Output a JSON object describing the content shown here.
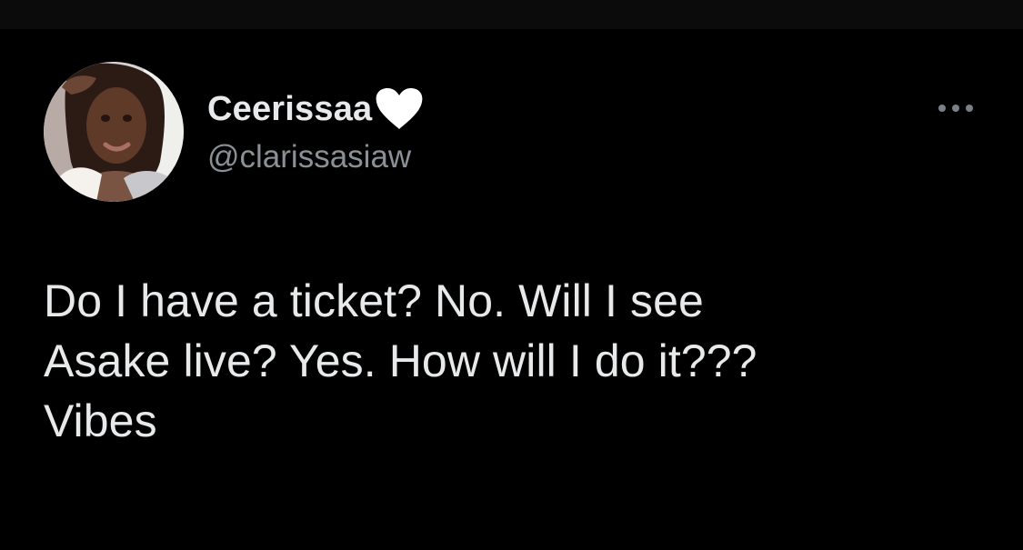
{
  "user": {
    "display_name": "Ceerissaa",
    "handle": "@clarissasiaw",
    "avatar_icon": "user-avatar-photo",
    "name_emoji_icon": "white-heart-icon"
  },
  "menu": {
    "icon": "more-options-icon"
  },
  "tweet": {
    "text": "Do I have a ticket? No. Will I see\nAsake live? Yes. How will I do it???\nVibes"
  },
  "colors": {
    "background": "#000000",
    "primary_text": "#e7e9ea",
    "secondary_text": "#8b9096"
  }
}
